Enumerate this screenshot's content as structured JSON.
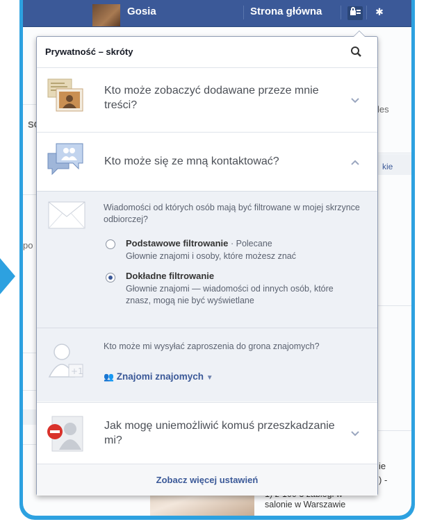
{
  "topbar": {
    "user_name": "Gosia",
    "home_label": "Strona główna",
    "privacy_icon": "privacy-shortcuts-icon",
    "settings_icon": "gear-icon"
  },
  "background": {
    "frag_les": "les",
    "frag_kie": "kie",
    "frag_sc": "SC",
    "frag_po": "po",
    "frag_ie": "ie",
    "frag_dash": ") -",
    "frag_salon": "1) z-100 3 zabiegi w",
    "frag_warsaw": "salonie w Warszawie"
  },
  "dropdown": {
    "title": "Prywatność – skróty",
    "rows": [
      {
        "label": "Kto może zobaczyć dodawane przeze mnie treści?"
      },
      {
        "label": "Kto może się ze mną kontaktować?"
      },
      {
        "label": "Jak mogę uniemożliwić komuś przeszkadzanie mi?"
      }
    ],
    "messages": {
      "question": "Wiadomości od których osób mają być filtrowane w mojej skrzynce odbiorczej?",
      "options": [
        {
          "title": "Podstawowe filtrowanie",
          "note": "· Polecane",
          "desc": "Głownie znajomi i osoby, które możesz znać",
          "selected": false
        },
        {
          "title": "Dokładne filtrowanie",
          "note": "",
          "desc": "Głownie znajomi — wiadomości od innych osób, które znasz, mogą nie być wyświetlane",
          "selected": true
        }
      ]
    },
    "friend_requests": {
      "question": "Kto może mi wysyłać zaproszenia do grona znajomych?",
      "value": "Znajomi znajomych"
    },
    "footer_link": "Zobacz więcej ustawień"
  },
  "colors": {
    "frame": "#2da1e0",
    "topbar": "#3b5998",
    "link": "#3b5998",
    "panel": "#eef1f6"
  }
}
